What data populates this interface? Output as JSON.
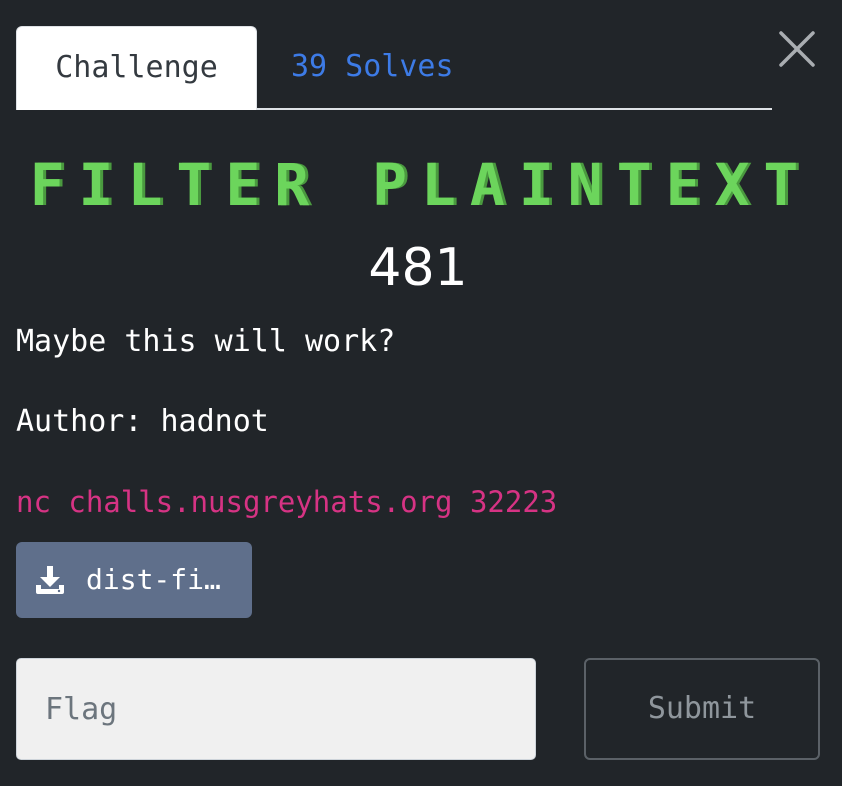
{
  "tabs": [
    {
      "label": "Challenge",
      "active": true
    },
    {
      "label": "39 Solves",
      "active": false
    }
  ],
  "close": {
    "icon": "close-icon"
  },
  "challenge": {
    "name": "FILTER PLAINTEXT",
    "value": "481",
    "description": "Maybe this will work?",
    "author": "Author: hadnot",
    "connection": "nc challs.nusgreyhats.org 32223"
  },
  "files": [
    {
      "label": "dist-fi…",
      "icon": "download-icon"
    }
  ],
  "form": {
    "flag_placeholder": "Flag",
    "flag_value": "",
    "submit_label": "Submit"
  },
  "colors": {
    "background": "#212529",
    "title": "#6cd55c",
    "link": "#3d7be6",
    "code": "#d63384",
    "file_button": "#5f6f8b"
  }
}
